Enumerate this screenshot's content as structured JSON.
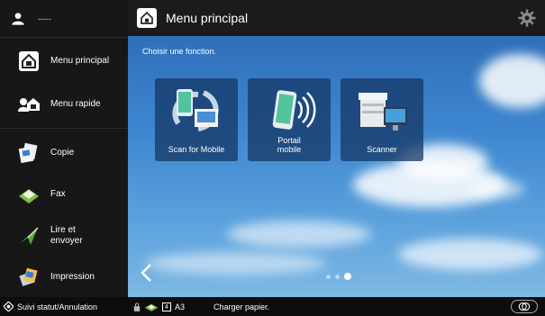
{
  "user": {
    "name": "-----",
    "icon": "user-icon"
  },
  "sidebar": {
    "items": [
      {
        "label": "Menu principal",
        "icon": "home-icon"
      },
      {
        "label": "Menu rapide",
        "icon": "quick-menu-icon"
      },
      {
        "label": "Copie",
        "icon": "copy-icon"
      },
      {
        "label": "Fax",
        "icon": "fax-icon"
      },
      {
        "label": "Lire et envoyer",
        "icon": "scan-send-icon"
      },
      {
        "label": "Impression",
        "icon": "print-icon"
      }
    ]
  },
  "header": {
    "title": "Menu principal",
    "settings_icon": "gear-icon"
  },
  "main": {
    "hint": "Choisir une fonction.",
    "tiles": [
      {
        "label": "Scan for Mobile",
        "icon": "scan-for-mobile-icon"
      },
      {
        "label": "Portail mobile",
        "icon": "mobile-portal-icon"
      },
      {
        "label": "Scanner",
        "icon": "scanner-icon"
      }
    ],
    "pages": {
      "count": 3,
      "current": 3
    }
  },
  "status": {
    "job_status": "Suivi statut/Annulation",
    "paper_tray": "4",
    "paper_size": "A3",
    "message": "Charger papier."
  },
  "colors": {
    "sky_top": "#2f6fb8",
    "sky_bottom": "#7fb8e4",
    "sidebar_bg": "#171717",
    "tile_bg": "#14376e"
  }
}
